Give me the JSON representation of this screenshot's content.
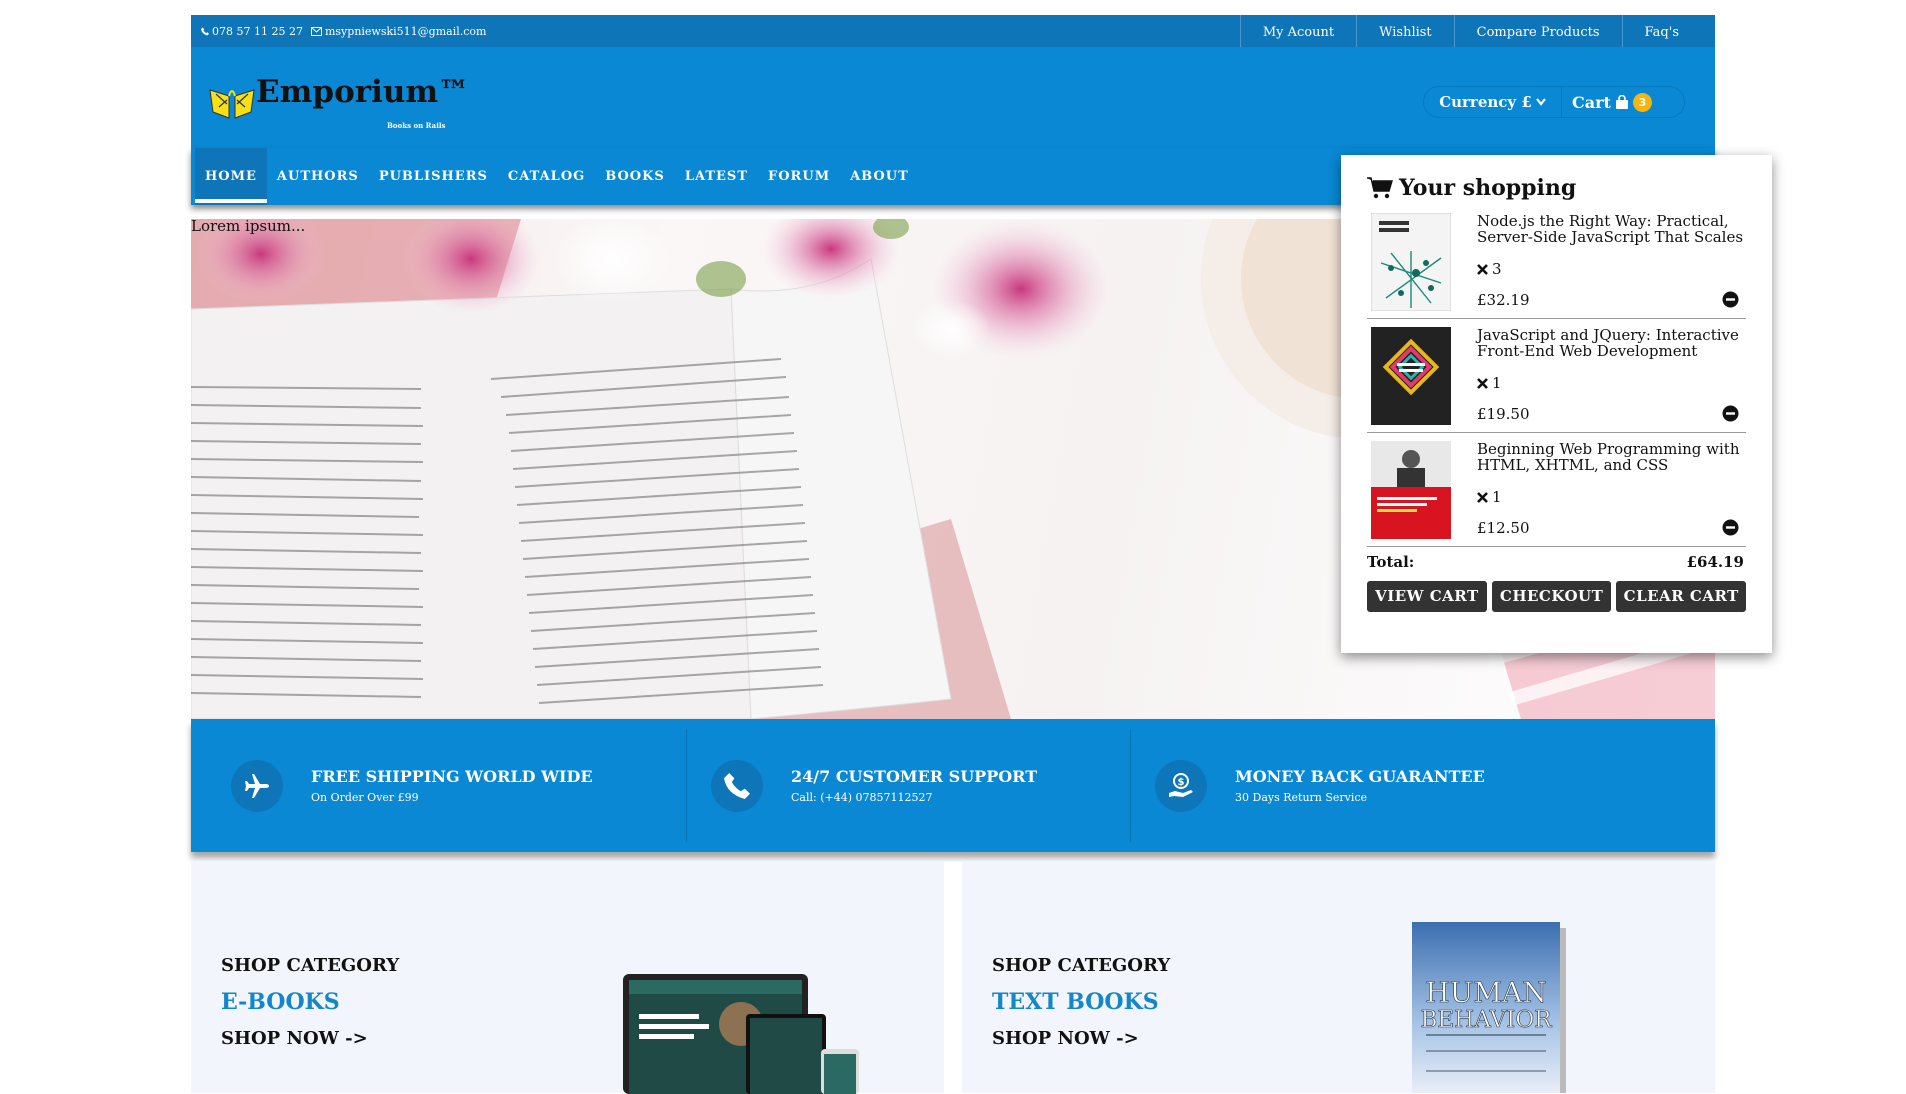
{
  "topbar": {
    "phone": "078 57 11 25 27",
    "email": "msypniewski511@gmail.com",
    "links": [
      "My Acount",
      "Wishlist",
      "Compare Products",
      "Faq's"
    ]
  },
  "header": {
    "brand": "Emporium™",
    "tagline": "Books on Rails",
    "currency_label": "Currency £",
    "cart_label": "Cart",
    "cart_count": "3"
  },
  "nav": {
    "items": [
      "HOME",
      "AUTHORS",
      "PUBLISHERS",
      "CATALOG",
      "BOOKS",
      "LATEST",
      "FORUM",
      "ABOUT"
    ]
  },
  "hero": {
    "caption": "Lorem ipsum..."
  },
  "features": [
    {
      "title": "FREE SHIPPING WORLD WIDE",
      "sub": "On Order Over £99",
      "icon": "airplane-icon"
    },
    {
      "title": "24/7 CUSTOMER SUPPORT",
      "sub": "Call: (+44) 07857112527",
      "icon": "phone-icon"
    },
    {
      "title": "MONEY BACK GUARANTEE",
      "sub": "30 Days Return Service",
      "icon": "money-hand-icon"
    }
  ],
  "categories": [
    {
      "label": "SHOP CATEGORY",
      "name": "E-BOOKS",
      "cta": "SHOP NOW ->"
    },
    {
      "label": "SHOP CATEGORY",
      "name": "TEXT BOOKS",
      "cta": "SHOP NOW ->"
    }
  ],
  "cart_popup": {
    "heading": "Your shopping",
    "items": [
      {
        "title": "Node.js the Right Way: Practical, Server-Side JavaScript That Scales",
        "qty": "3",
        "price": "£32.19"
      },
      {
        "title": "JavaScript and JQuery: Interactive Front-End Web Development",
        "qty": "1",
        "price": "£19.50"
      },
      {
        "title": "Beginning Web Programming with HTML, XHTML, and CSS",
        "qty": "1",
        "price": "£12.50"
      }
    ],
    "total_label": "Total:",
    "total_value": "£64.19",
    "buttons": [
      "VIEW CART",
      "CHECKOUT",
      "CLEAR CART"
    ]
  },
  "colors": {
    "primary": "#0a88d4",
    "dark_primary": "#0e75b8",
    "badge": "#f5b50d",
    "accent_text": "#1387c9"
  }
}
